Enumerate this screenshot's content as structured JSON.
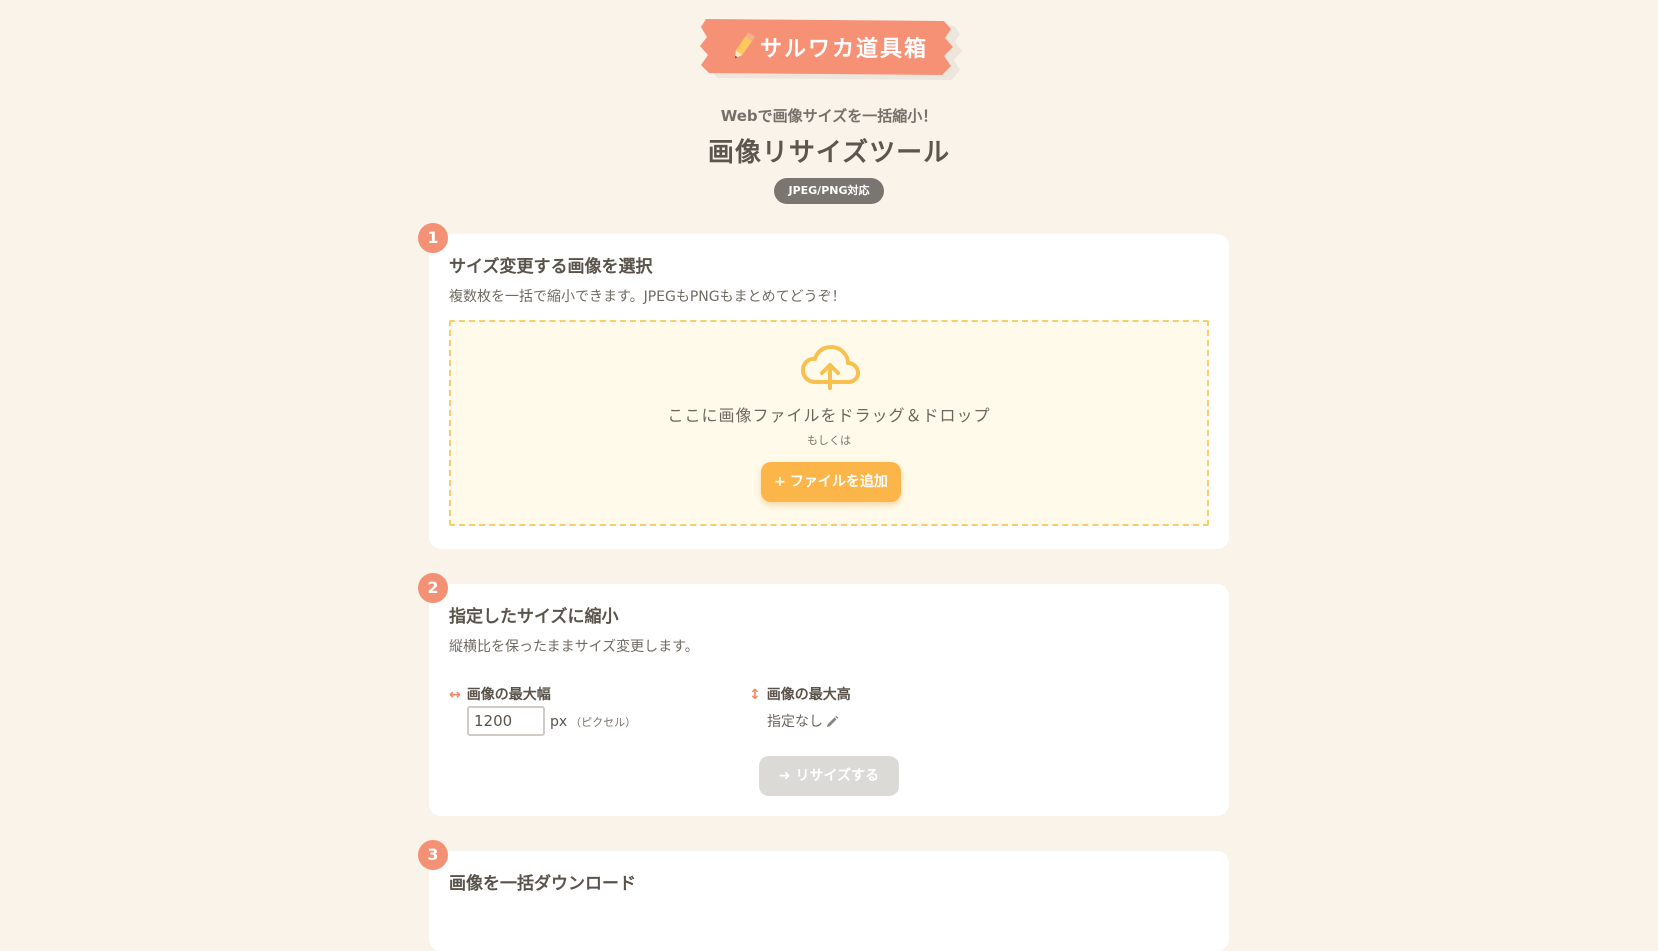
{
  "logo": {
    "text": "サルワカ道具箱",
    "icon": "pencil-icon"
  },
  "header": {
    "subtitle": "Webで画像サイズを一括縮小！",
    "title": "画像リサイズツール",
    "badge": "JPEG/PNG対応"
  },
  "steps": [
    {
      "number": "1",
      "title": "サイズ変更する画像を選択",
      "description": "複数枚を一括で縮小できます。JPEGもPNGもまとめてどうぞ！",
      "dropzone": {
        "icon": "cloud-upload-icon",
        "text": "ここに画像ファイルをドラッグ＆ドロップ",
        "or": "もしくは",
        "button_plus": "+",
        "button_label": "ファイルを追加"
      }
    },
    {
      "number": "2",
      "title": "指定したサイズに縮小",
      "description": "縦横比を保ったままサイズ変更します。",
      "max_width": {
        "arrow": "↔",
        "label": "画像の最大幅",
        "value": "1200",
        "unit": "px",
        "unit_note": "（ピクセル）"
      },
      "max_height": {
        "arrow": "↕",
        "label": "画像の最大高",
        "value": "指定なし"
      },
      "resize_button": "➜ リサイズする"
    },
    {
      "number": "3",
      "title": "画像を一括ダウンロード"
    }
  ],
  "colors": {
    "background": "#f9f3ea",
    "accent": "#f49073",
    "button": "#fbb548",
    "dropzone_border": "#f5cf6e",
    "dropzone_bg": "#fffaea"
  }
}
